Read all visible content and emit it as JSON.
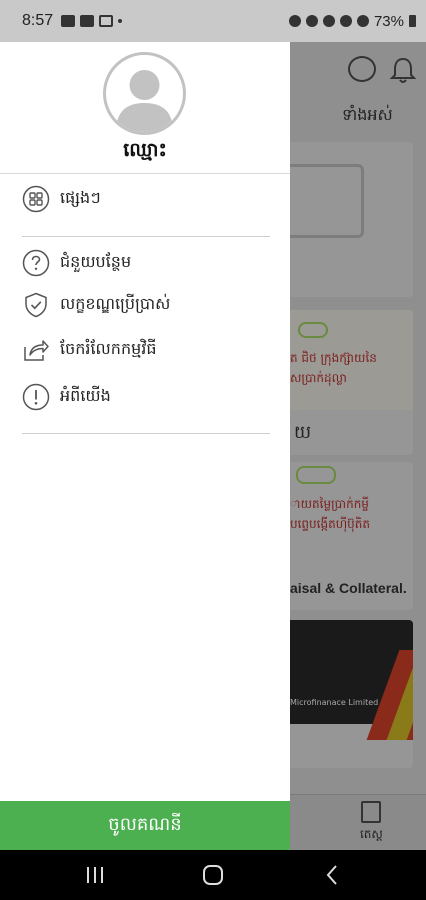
{
  "status_bar": {
    "time": "8:57",
    "battery": "73%"
  },
  "background_app": {
    "title_fragment": "ទាំងអស់",
    "card2_text1": "ត ជិថ ក្រុងក្ស៊ាយនៃ",
    "card2_text2": "សប្រាក់ដុល្លា",
    "card2_label": "យ",
    "card3_text1": "ាយតម្លៃប្រាក់កម្ចី",
    "card3_text2": "បព្ទេបង្កើតហ៊ីប៊ុតិត",
    "card3_label": "aisal & Collateral.",
    "card4_small": "Microfinanace Limited",
    "bottom_tab_label": "តេស្ត"
  },
  "drawer": {
    "profile_name": "ឈ្មោះ",
    "items": [
      {
        "label": "ផ្សេងៗ",
        "icon": "grid-icon"
      },
      {
        "label": "ជំនួយបន្ថែម",
        "icon": "help-circle-icon"
      },
      {
        "label": "លក្ខខណ្ឌប្រើប្រាស់",
        "icon": "shield-check-icon"
      },
      {
        "label": "ចែករំលែកកម្មវិធី",
        "icon": "share-icon"
      },
      {
        "label": "អំពីយើង",
        "icon": "info-icon"
      }
    ],
    "login_label": "ចូលគណនី"
  },
  "colors": {
    "login_button": "#4caf50",
    "drawer_bg": "#ffffff",
    "scrim": "#8c8c8c"
  }
}
